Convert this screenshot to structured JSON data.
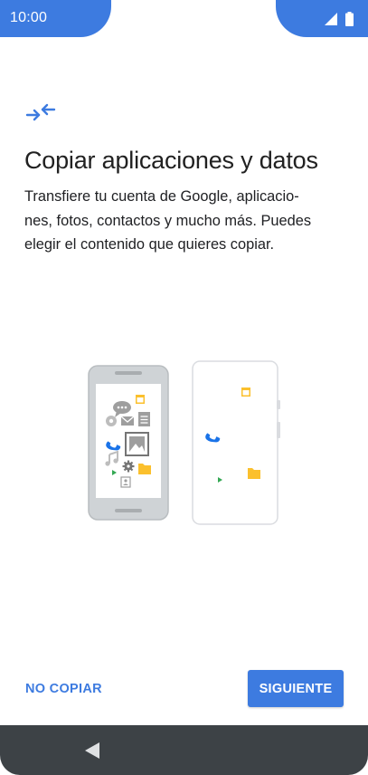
{
  "status_bar": {
    "time": "10:00",
    "icons": [
      "signal-icon",
      "battery-icon"
    ],
    "color": "#3d7be0"
  },
  "header_icon": "transfer-arrows-icon",
  "title": "Copiar aplicaciones y datos",
  "description_lines": [
    "Transfiere tu cuenta de Google, aplicacio-",
    "nes, fotos, contactos y mucho más. Puedes",
    "elegir el contenido que quieres copiar."
  ],
  "illustration": {
    "name": "phone-to-phone-transfer",
    "source_icons": [
      "chat-icon",
      "calendar-icon",
      "settings-icon",
      "mail-icon",
      "document-icon",
      "phone-icon",
      "image-icon",
      "music-icon",
      "play-icon",
      "gear-icon",
      "folder-icon",
      "contact-icon"
    ],
    "target_icons": [
      "calendar-icon",
      "phone-icon",
      "play-icon",
      "folder-icon"
    ]
  },
  "actions": {
    "skip_label": "NO COPIAR",
    "next_label": "SIGUIENTE"
  },
  "navigation": {
    "back_icon": "back-triangle-icon"
  },
  "colors": {
    "accent": "#3d7be0",
    "navbar": "#3d4246",
    "text": "#212121"
  }
}
